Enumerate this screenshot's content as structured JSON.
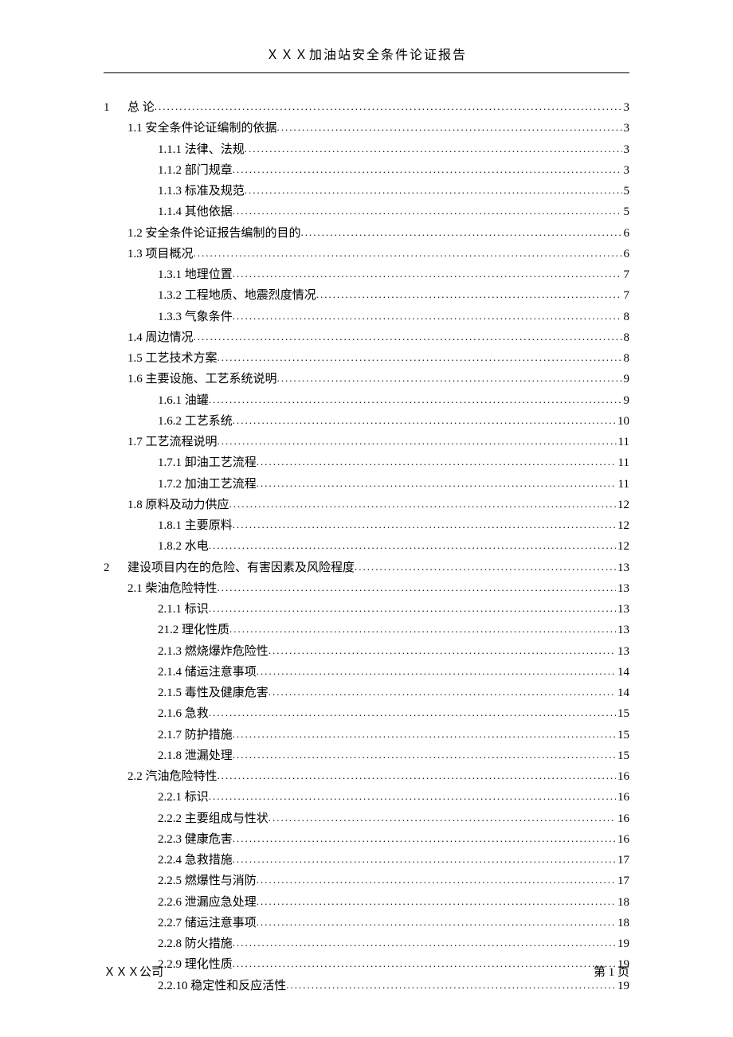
{
  "header": {
    "title": "ＸＸＸ加油站安全条件论证报告"
  },
  "toc": [
    {
      "level": 0,
      "num": "1",
      "text": "总 论",
      "page": "3"
    },
    {
      "level": 1,
      "text": "1.1 安全条件论证编制的依据",
      "page": "3"
    },
    {
      "level": 2,
      "text": "1.1.1 法律、法规",
      "page": "3"
    },
    {
      "level": 2,
      "text": "1.1.2 部门规章",
      "page": "3"
    },
    {
      "level": 2,
      "text": "1.1.3 标准及规范",
      "page": "5"
    },
    {
      "level": 2,
      "text": "1.1.4 其他依据",
      "page": "5"
    },
    {
      "level": 1,
      "text": "1.2 安全条件论证报告编制的目的",
      "page": "6"
    },
    {
      "level": 1,
      "text": "1.3 项目概况",
      "page": "6"
    },
    {
      "level": 2,
      "text": "1.3.1 地理位置",
      "page": "7"
    },
    {
      "level": 2,
      "text": "1.3.2 工程地质、地震烈度情况",
      "page": "7"
    },
    {
      "level": 2,
      "text": "1.3.3 气象条件",
      "page": "8"
    },
    {
      "level": 1,
      "text": "1.4 周边情况",
      "page": "8"
    },
    {
      "level": 1,
      "text": "1.5 工艺技术方案",
      "page": "8"
    },
    {
      "level": 1,
      "text": "1.6 主要设施、工艺系统说明",
      "page": "9"
    },
    {
      "level": 2,
      "text": "1.6.1 油罐",
      "page": "9"
    },
    {
      "level": 2,
      "text": "1.6.2 工艺系统",
      "page": "10"
    },
    {
      "level": 1,
      "text": "1.7 工艺流程说明",
      "page": "11"
    },
    {
      "level": 2,
      "text": "1.7.1 卸油工艺流程",
      "page": "11"
    },
    {
      "level": 2,
      "text": "1.7.2 加油工艺流程",
      "page": "11"
    },
    {
      "level": 1,
      "text": "1.8 原料及动力供应",
      "page": "12"
    },
    {
      "level": 2,
      "text": "1.8.1 主要原料",
      "page": "12"
    },
    {
      "level": 2,
      "text": "1.8.2 水电",
      "page": "12"
    },
    {
      "level": 0,
      "num": "2",
      "text": "建设项目内在的危险、有害因素及风险程度",
      "page": "13"
    },
    {
      "level": 1,
      "text": "2.1 柴油危险特性",
      "page": "13"
    },
    {
      "level": 2,
      "text": "2.1.1 标识",
      "page": "13"
    },
    {
      "level": 2,
      "text": "21.2 理化性质",
      "page": "13"
    },
    {
      "level": 2,
      "text": "2.1.3 燃烧爆炸危险性",
      "page": "13"
    },
    {
      "level": 2,
      "text": "2.1.4 储运注意事项",
      "page": "14"
    },
    {
      "level": 2,
      "text": "2.1.5 毒性及健康危害",
      "page": "14"
    },
    {
      "level": 2,
      "text": "2.1.6 急救",
      "page": "15"
    },
    {
      "level": 2,
      "text": "2.1.7 防护措施",
      "page": "15"
    },
    {
      "level": 2,
      "text": "2.1.8 泄漏处理",
      "page": "15"
    },
    {
      "level": 1,
      "text": "2.2 汽油危险特性",
      "page": "16"
    },
    {
      "level": 2,
      "text": "2.2.1 标识",
      "page": "16"
    },
    {
      "level": 2,
      "text": "2.2.2 主要组成与性状",
      "page": "16"
    },
    {
      "level": 2,
      "text": "2.2.3 健康危害",
      "page": "16"
    },
    {
      "level": 2,
      "text": "2.2.4 急救措施",
      "page": "17"
    },
    {
      "level": 2,
      "text": "2.2.5 燃爆性与消防",
      "page": "17"
    },
    {
      "level": 2,
      "text": "2.2.6 泄漏应急处理",
      "page": "18"
    },
    {
      "level": 2,
      "text": "2.2.7 储运注意事项",
      "page": "18"
    },
    {
      "level": 2,
      "text": "2.2.8 防火措施",
      "page": "19"
    },
    {
      "level": 2,
      "text": "2.2.9 理化性质",
      "page": "19"
    },
    {
      "level": 2,
      "text": "2.2.10 稳定性和反应活性",
      "page": "19"
    }
  ],
  "footer": {
    "company": "ＸＸＸ公司",
    "page_label": "第 1 页"
  }
}
